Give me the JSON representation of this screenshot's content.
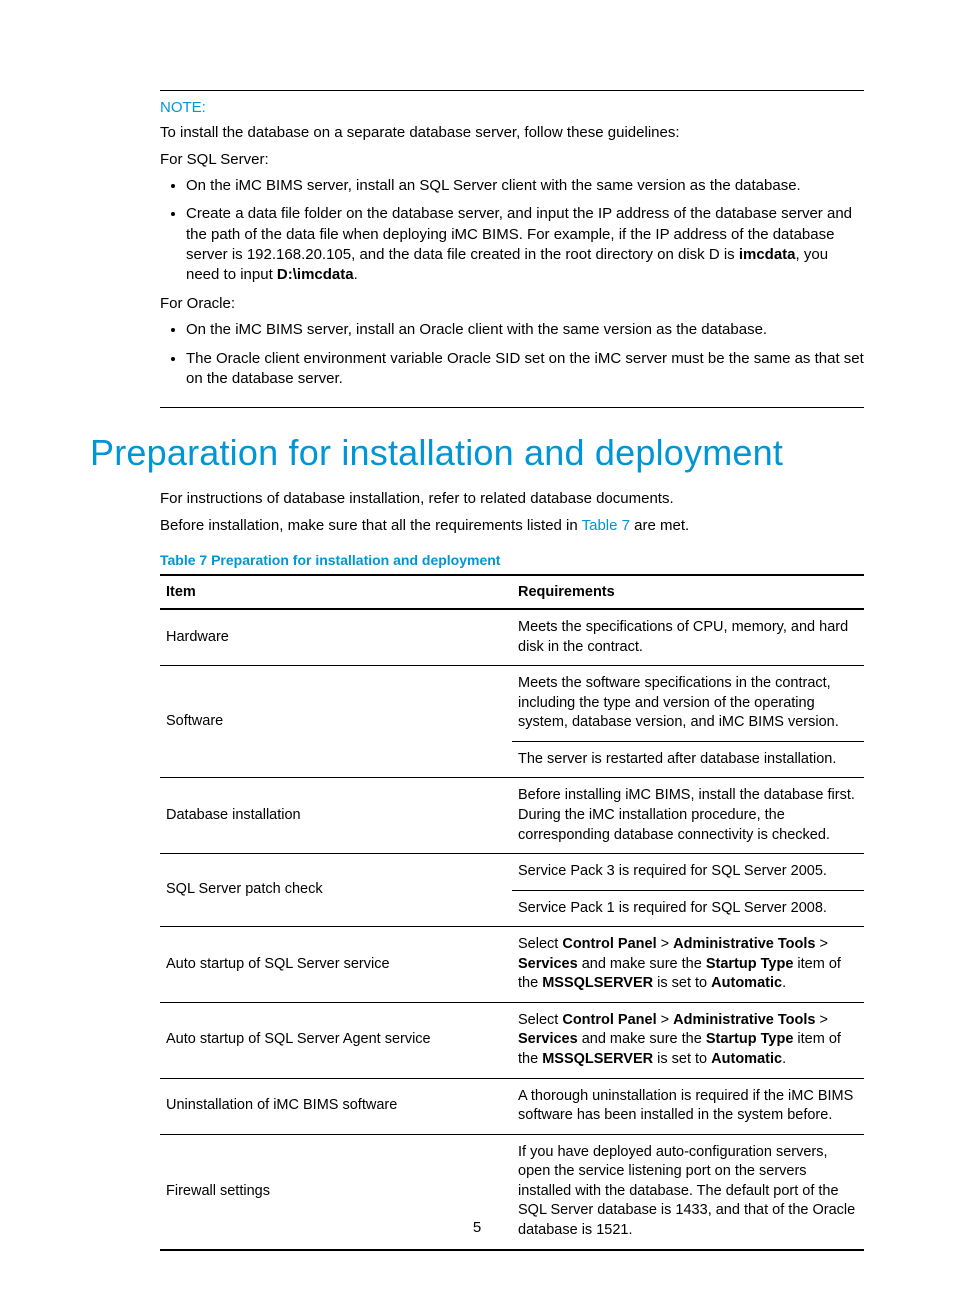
{
  "note": {
    "label": "NOTE:",
    "intro": "To install the database on a separate database server, follow these guidelines:",
    "sql_label": "For SQL Server:",
    "sql_items": [
      "On the iMC BIMS server, install an SQL Server client with the same version as the database.",
      "Create a data file folder on the database server, and input the IP address of the database server and the path of the data file when deploying iMC BIMS. For example, if the IP address of the database server is 192.168.20.105, and the data file created in the root directory on disk D is "
    ],
    "sql_item2_bold1": "imcdata",
    "sql_item2_mid": ", you need to input ",
    "sql_item2_bold2": "D:\\imcdata",
    "sql_item2_end": ".",
    "oracle_label": "For Oracle:",
    "oracle_items": [
      "On the iMC BIMS server, install an Oracle client with the same version as the database.",
      "The Oracle client environment variable Oracle SID set on the iMC server must be the same as that set on the database server."
    ]
  },
  "section": {
    "title": "Preparation for installation and deployment",
    "p1": "For instructions of database installation, refer to related database documents.",
    "p2_pre": "Before installation, make sure that all the requirements listed in ",
    "p2_link": "Table 7",
    "p2_post": " are met.",
    "table_caption": "Table 7 Preparation for installation and deployment"
  },
  "table": {
    "h_item": "Item",
    "h_req": "Requirements",
    "rows": {
      "r0_item": "Hardware",
      "r0_req": "Meets the specifications of CPU, memory, and hard disk in the contract.",
      "r1_item": "Software",
      "r1_req_a": "Meets the software specifications in the contract, including the type and version of the operating system, database version, and iMC BIMS version.",
      "r1_req_b": "The server is restarted after database installation.",
      "r2_item": "Database installation",
      "r2_req": "Before installing iMC BIMS, install the database first. During the iMC installation procedure, the corresponding database connectivity is checked.",
      "r3_item": "SQL Server patch check",
      "r3_req_a": "Service Pack 3 is required for SQL Server 2005.",
      "r3_req_b": "Service Pack 1 is required for SQL Server 2008.",
      "r4_item": "Auto startup of SQL Server service",
      "r4_parts": {
        "a": "Select ",
        "b": "Control Panel",
        "c": " > ",
        "d": "Administrative Tools",
        "e": " > ",
        "f": "Services",
        "g": " and make sure the ",
        "h": "Startup Type",
        "i": " item of the ",
        "j": "MSSQLSERVER",
        "k": " is set to ",
        "l": "Automatic",
        "m": "."
      },
      "r5_item": "Auto startup of SQL Server Agent service",
      "r6_item": "Uninstallation of iMC BIMS software",
      "r6_req": "A thorough uninstallation is required if the iMC BIMS software has been installed in the system before.",
      "r7_item": "Firewall settings",
      "r7_req": "If you have deployed auto-configuration servers, open the service listening port on the servers installed with the database. The default port of the SQL Server database is 1433, and that of the Oracle database is 1521."
    }
  },
  "page_number": "5"
}
